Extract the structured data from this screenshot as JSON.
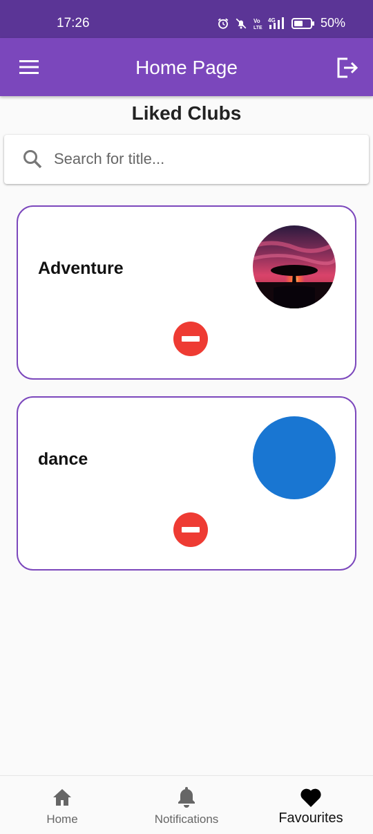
{
  "status_bar": {
    "time": "17:26",
    "network_label": "4G",
    "battery": "50%"
  },
  "app_bar": {
    "title": "Home Page",
    "menu_icon": "menu-icon",
    "logout_icon": "logout-icon",
    "background_color": "#7b47bc"
  },
  "page": {
    "section_title": "Liked Clubs"
  },
  "search": {
    "placeholder": "Search for title...",
    "value": ""
  },
  "clubs": [
    {
      "name": "Adventure",
      "image": "sunset-tree-photo",
      "action": "remove"
    },
    {
      "name": "dance",
      "image_color": "#1976d2",
      "action": "remove"
    }
  ],
  "bottom_nav": {
    "items": [
      {
        "label": "Home",
        "icon": "home-icon",
        "active": false
      },
      {
        "label": "Notifications",
        "icon": "bell-icon",
        "active": false
      },
      {
        "label": "Favourites",
        "icon": "heart-icon",
        "active": true
      }
    ]
  },
  "colors": {
    "accent": "#7b47bc",
    "status_bar": "#5b3596",
    "remove": "#ee3b33"
  }
}
